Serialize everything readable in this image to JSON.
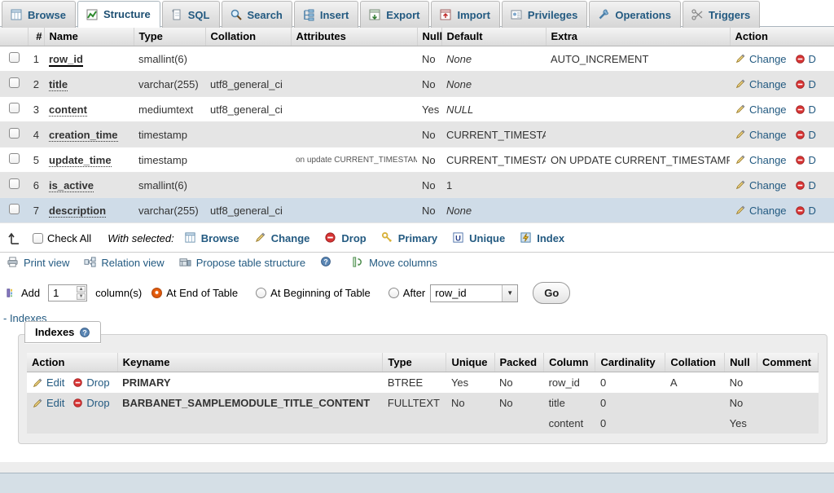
{
  "tabs": [
    {
      "label": "Browse",
      "icon": "browse-icon",
      "active": false
    },
    {
      "label": "Structure",
      "icon": "structure-icon",
      "active": true
    },
    {
      "label": "SQL",
      "icon": "sql-icon",
      "active": false
    },
    {
      "label": "Search",
      "icon": "search-icon",
      "active": false
    },
    {
      "label": "Insert",
      "icon": "insert-icon",
      "active": false
    },
    {
      "label": "Export",
      "icon": "export-icon",
      "active": false
    },
    {
      "label": "Import",
      "icon": "import-icon",
      "active": false
    },
    {
      "label": "Privileges",
      "icon": "privileges-icon",
      "active": false
    },
    {
      "label": "Operations",
      "icon": "operations-icon",
      "active": false
    },
    {
      "label": "Triggers",
      "icon": "triggers-icon",
      "active": false
    }
  ],
  "structure": {
    "headers": [
      "#",
      "Name",
      "Type",
      "Collation",
      "Attributes",
      "Null",
      "Default",
      "Extra",
      "Action"
    ],
    "rows": [
      {
        "num": "1",
        "name": "row_id",
        "key": "primary",
        "type": "smallint(6)",
        "collation": "",
        "attributes": "",
        "null": "No",
        "default": "None",
        "default_style": "italic",
        "extra": "AUTO_INCREMENT",
        "change": "Change",
        "drop": "D"
      },
      {
        "num": "2",
        "name": "title",
        "key": "index",
        "type": "varchar(255)",
        "collation": "utf8_general_ci",
        "attributes": "",
        "null": "No",
        "default": "None",
        "default_style": "italic",
        "extra": "",
        "change": "Change",
        "drop": "D"
      },
      {
        "num": "3",
        "name": "content",
        "key": "index",
        "type": "mediumtext",
        "collation": "utf8_general_ci",
        "attributes": "",
        "null": "Yes",
        "default": "NULL",
        "default_style": "italic",
        "extra": "",
        "change": "Change",
        "drop": "D"
      },
      {
        "num": "4",
        "name": "creation_time",
        "key": "index",
        "type": "timestamp",
        "collation": "",
        "attributes": "",
        "null": "No",
        "default": "CURRENT_TIMESTAMP",
        "default_style": "plain",
        "extra": "",
        "change": "Change",
        "drop": "D"
      },
      {
        "num": "5",
        "name": "update_time",
        "key": "index",
        "type": "timestamp",
        "collation": "",
        "attributes": "on update CURRENT_TIMESTAMP",
        "null": "No",
        "default": "CURRENT_TIMESTAMP",
        "default_style": "plain",
        "extra": "ON UPDATE CURRENT_TIMESTAMP",
        "change": "Change",
        "drop": "D"
      },
      {
        "num": "6",
        "name": "is_active",
        "key": "index",
        "type": "smallint(6)",
        "collation": "",
        "attributes": "",
        "null": "No",
        "default": "1",
        "default_style": "plain",
        "extra": "",
        "change": "Change",
        "drop": "D"
      },
      {
        "num": "7",
        "name": "description",
        "key": "index",
        "type": "varchar(255)",
        "collation": "utf8_general_ci",
        "attributes": "",
        "null": "No",
        "default": "None",
        "default_style": "italic",
        "extra": "",
        "change": "Change",
        "drop": "D"
      }
    ]
  },
  "actionbar": {
    "check_all": "Check All",
    "with_selected": "With selected:",
    "buttons": [
      {
        "label": "Browse",
        "icon": "browse-icon"
      },
      {
        "label": "Change",
        "icon": "pencil-icon"
      },
      {
        "label": "Drop",
        "icon": "drop-icon"
      },
      {
        "label": "Primary",
        "icon": "key-icon"
      },
      {
        "label": "Unique",
        "icon": "unique-icon"
      },
      {
        "label": "Index",
        "icon": "index-icon"
      }
    ]
  },
  "toolrow": {
    "buttons": [
      {
        "label": "Print view",
        "icon": "printer-icon"
      },
      {
        "label": "Relation view",
        "icon": "relation-icon"
      },
      {
        "label": "Propose table structure",
        "icon": "propose-icon"
      },
      {
        "label": "",
        "icon": "help-icon"
      },
      {
        "label": "Move columns",
        "icon": "move-columns-icon"
      }
    ]
  },
  "addform": {
    "add_label": "Add",
    "count_value": "1",
    "columns_label": "column(s)",
    "at_end": "At End of Table",
    "at_beginning": "At Beginning of Table",
    "after": "After",
    "after_select_value": "row_id",
    "go_label": "Go",
    "selected_position": "at_end"
  },
  "indexes_link": "- Indexes",
  "indexes": {
    "legend": "Indexes",
    "headers": [
      "Action",
      "Keyname",
      "Type",
      "Unique",
      "Packed",
      "Column",
      "Cardinality",
      "Collation",
      "Null",
      "Comment"
    ],
    "rows": [
      {
        "edit": "Edit",
        "drop": "Drop",
        "keyname": "PRIMARY",
        "type": "BTREE",
        "unique": "Yes",
        "packed": "No",
        "column": "row_id",
        "cardinality": "0",
        "collation": "A",
        "null": "No",
        "comment": "",
        "show_actions": true
      },
      {
        "edit": "Edit",
        "drop": "Drop",
        "keyname": "BARBANET_SAMPLEMODULE_TITLE_CONTENT",
        "type": "FULLTEXT",
        "unique": "No",
        "packed": "No",
        "column": "title",
        "cardinality": "0",
        "collation": "",
        "null": "No",
        "comment": "",
        "show_actions": true
      },
      {
        "edit": "",
        "drop": "",
        "keyname": "",
        "type": "",
        "unique": "",
        "packed": "",
        "column": "content",
        "cardinality": "0",
        "collation": "",
        "null": "Yes",
        "comment": "",
        "show_actions": false
      }
    ]
  },
  "colors": {
    "link": "#235a81",
    "accent_orange": "#cf4b06",
    "row_marked": "#cfdce8",
    "row_even": "#e5e5e5",
    "bottom_band": "#d5dfe6"
  }
}
